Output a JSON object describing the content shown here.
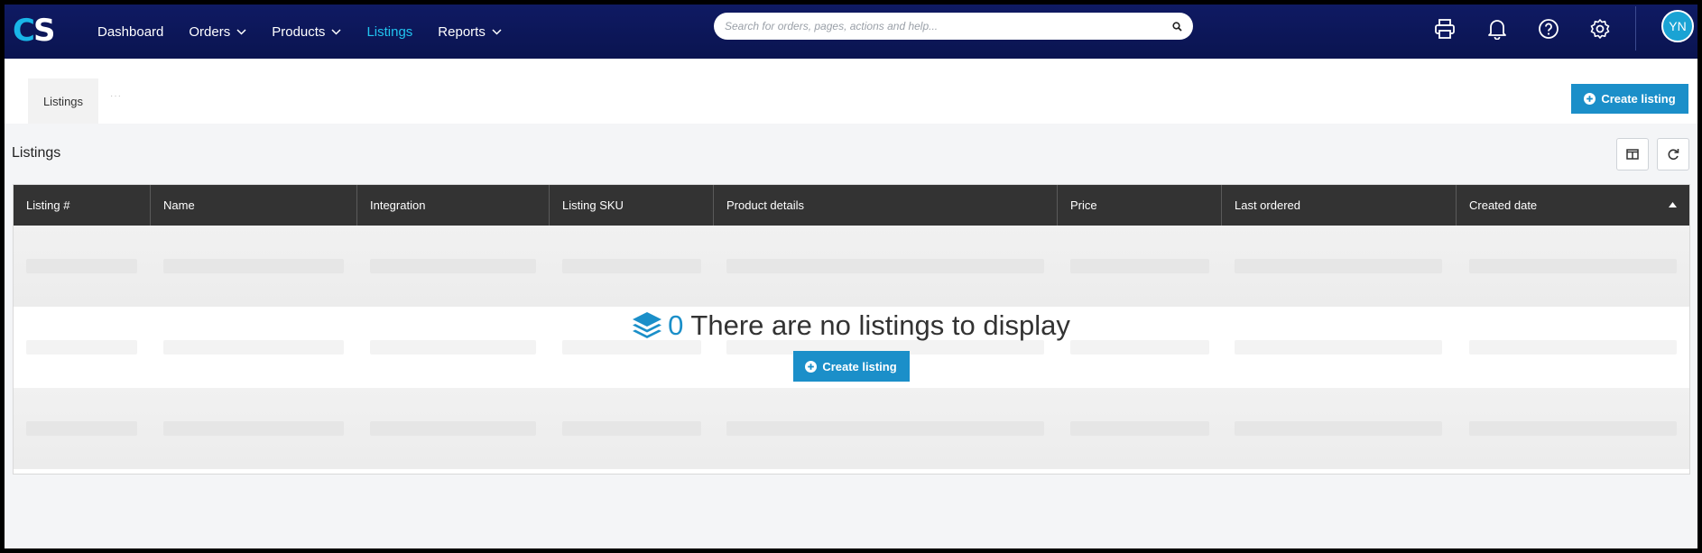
{
  "logo": {
    "c": "C",
    "s": "S"
  },
  "nav": {
    "items": [
      {
        "label": "Dashboard",
        "dropdown": false,
        "active": false
      },
      {
        "label": "Orders",
        "dropdown": true,
        "active": false
      },
      {
        "label": "Products",
        "dropdown": true,
        "active": false
      },
      {
        "label": "Listings",
        "dropdown": false,
        "active": true
      },
      {
        "label": "Reports",
        "dropdown": true,
        "active": false
      }
    ]
  },
  "search": {
    "placeholder": "Search for orders, pages, actions and help...",
    "value": ""
  },
  "header_icons": [
    "printer-icon",
    "bell-icon",
    "help-icon",
    "gear-icon"
  ],
  "user": {
    "initials": "YN"
  },
  "tabs": {
    "active_label": "Listings",
    "more_label": "···"
  },
  "actions": {
    "create_listing_label": "Create listing"
  },
  "section": {
    "title": "Listings"
  },
  "table": {
    "columns": [
      {
        "label": "Listing #",
        "sorted": false
      },
      {
        "label": "Name",
        "sorted": false
      },
      {
        "label": "Integration",
        "sorted": false
      },
      {
        "label": "Listing SKU",
        "sorted": false
      },
      {
        "label": "Product details",
        "sorted": false
      },
      {
        "label": "Price",
        "sorted": false
      },
      {
        "label": "Last ordered",
        "sorted": false
      },
      {
        "label": "Created date",
        "sorted": true,
        "sort_direction": "asc"
      }
    ]
  },
  "empty_state": {
    "count": "0",
    "message": "There are no listings to display",
    "button_label": "Create listing"
  },
  "colors": {
    "nav_bg": "#0f1a63",
    "accent": "#1b8fc9",
    "active_nav": "#21c4f0",
    "table_header": "#333333"
  }
}
